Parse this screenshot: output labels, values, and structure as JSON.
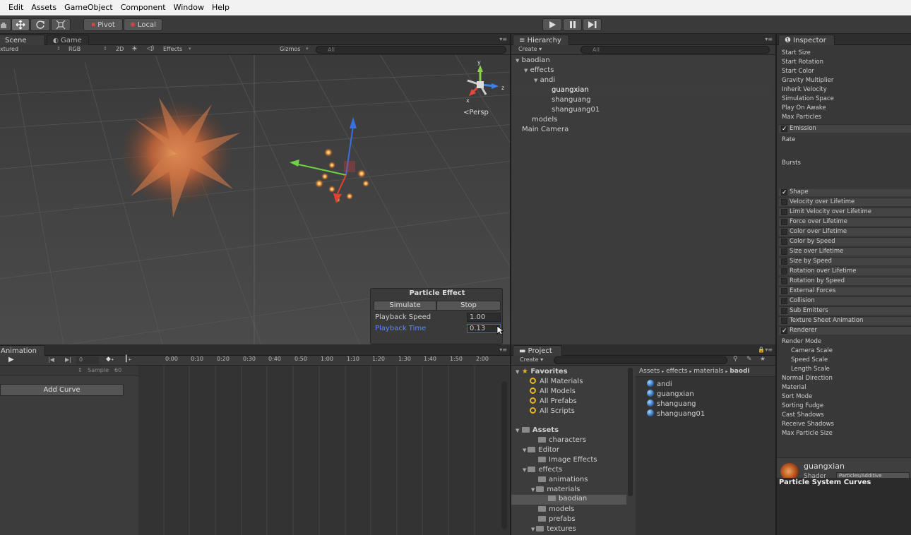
{
  "menu": [
    "Edit",
    "Assets",
    "GameObject",
    "Component",
    "Window",
    "Help"
  ],
  "toolbar": {
    "pivot": "Pivot",
    "local": "Local",
    "play_icon": "play-icon",
    "pause_icon": "pause-icon",
    "step_icon": "step-icon"
  },
  "scene": {
    "tabs": [
      "Scene",
      "Game"
    ],
    "shading": "xtured",
    "render_mode": "RGB",
    "mode_2d": "2D",
    "effects": "Effects",
    "gizmos": "Gizmos",
    "search_placeholder": "All",
    "persp": "Persp",
    "axis_y": "y",
    "axis_z": "z",
    "axis_x": "x"
  },
  "particle_effect": {
    "title": "Particle Effect",
    "simulate": "Simulate",
    "stop": "Stop",
    "playback_speed_label": "Playback Speed",
    "playback_speed": "1.00",
    "playback_time_label": "Playback Time",
    "playback_time": "0.13"
  },
  "hierarchy": {
    "tab": "Hierarchy",
    "create": "Create",
    "search_placeholder": "All",
    "items": [
      {
        "label": "baodian",
        "arrow": "▼"
      },
      {
        "label": "effects",
        "arrow": "▼"
      },
      {
        "label": "andi",
        "arrow": "▼"
      },
      {
        "label": "guangxian",
        "arrow": ""
      },
      {
        "label": "shanguang",
        "arrow": ""
      },
      {
        "label": "shanguang01",
        "arrow": ""
      },
      {
        "label": "models",
        "arrow": ""
      },
      {
        "label": "Main Camera",
        "arrow": ""
      }
    ]
  },
  "inspector": {
    "tab": "Inspector",
    "props": [
      "Start Size",
      "Start Rotation",
      "Start Color",
      "Gravity Multiplier",
      "Inherit Velocity",
      "Simulation Space",
      "Play On Awake",
      "Max Particles"
    ],
    "emission": "Emission",
    "rate": "Rate",
    "bursts": "Bursts",
    "modules": [
      {
        "label": "Shape",
        "checked": "✓"
      },
      {
        "label": "Velocity over Lifetime",
        "checked": ""
      },
      {
        "label": "Limit Velocity over Lifetime",
        "checked": ""
      },
      {
        "label": "Force over Lifetime",
        "checked": ""
      },
      {
        "label": "Color over Lifetime",
        "checked": ""
      },
      {
        "label": "Color by Speed",
        "checked": ""
      },
      {
        "label": "Size over Lifetime",
        "checked": ""
      },
      {
        "label": "Size by Speed",
        "checked": ""
      },
      {
        "label": "Rotation over Lifetime",
        "checked": ""
      },
      {
        "label": "Rotation by Speed",
        "checked": ""
      },
      {
        "label": "External Forces",
        "checked": ""
      },
      {
        "label": "Collision",
        "checked": ""
      },
      {
        "label": "Sub Emitters",
        "checked": ""
      },
      {
        "label": "Texture Sheet Animation",
        "checked": ""
      },
      {
        "label": "Renderer",
        "checked": "✓"
      }
    ],
    "renderer_props": [
      "Render Mode",
      "Camera Scale",
      "Speed Scale",
      "Length Scale",
      "Normal Direction",
      "Material",
      "Sort Mode",
      "Sorting Fudge",
      "Cast Shadows",
      "Receive Shadows",
      "Max Particle Size"
    ],
    "material_name": "guangxian",
    "shader_label": "Shader",
    "shader_value": "Particles/Additive",
    "curves_title": "Particle System Curves"
  },
  "animation": {
    "tab": "Animation",
    "frame": "0",
    "sample_label": "Sample",
    "sample_value": "60",
    "add_curve": "Add Curve",
    "timeline": [
      "0:00",
      "0:10",
      "0:20",
      "0:30",
      "0:40",
      "0:50",
      "1:00",
      "1:10",
      "1:20",
      "1:30",
      "1:40",
      "1:50",
      "2:00"
    ]
  },
  "project": {
    "tab": "Project",
    "create": "Create",
    "favorites_label": "Favorites",
    "favorites": [
      "All Materials",
      "All Models",
      "All Prefabs",
      "All Scripts"
    ],
    "assets_label": "Assets",
    "tree": [
      {
        "label": "characters",
        "arrow": ""
      },
      {
        "label": "Editor",
        "arrow": "▼"
      },
      {
        "label": "Image Effects",
        "arrow": ""
      },
      {
        "label": "effects",
        "arrow": "▼"
      },
      {
        "label": "animations",
        "arrow": ""
      },
      {
        "label": "materials",
        "arrow": "▼"
      },
      {
        "label": "baodian",
        "arrow": ""
      },
      {
        "label": "models",
        "arrow": ""
      },
      {
        "label": "prefabs",
        "arrow": ""
      },
      {
        "label": "textures",
        "arrow": "▼"
      }
    ],
    "breadcrumb": [
      "Assets",
      "effects",
      "materials",
      "baodi"
    ],
    "files": [
      "andi",
      "guangxian",
      "shanguang",
      "shanguang01"
    ]
  },
  "colors": {
    "selection": "#3d6fb0",
    "accent_link": "#5d8bf0",
    "emission_orange": "#e07a3a"
  }
}
